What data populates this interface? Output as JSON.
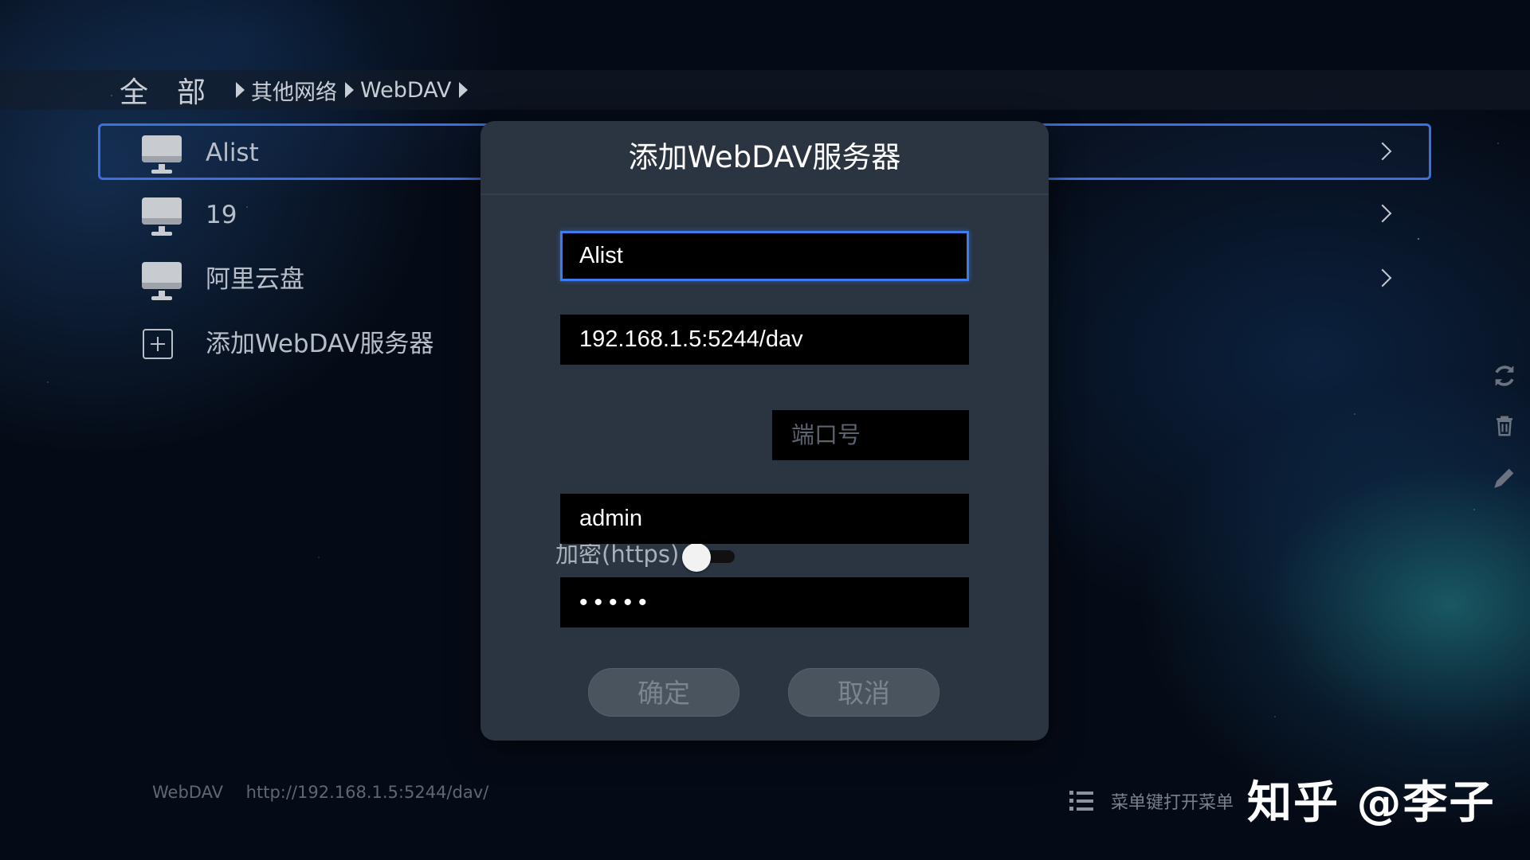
{
  "breadcrumb": {
    "root": "全部",
    "items": [
      "其他网络",
      "WebDAV"
    ]
  },
  "server_list": [
    {
      "label": "Alist",
      "icon": "monitor-icon",
      "selected": true
    },
    {
      "label": "19",
      "icon": "monitor-icon"
    },
    {
      "label": "阿里云盘",
      "icon": "monitor-icon"
    },
    {
      "label": "添加WebDAV服务器",
      "icon": "add-box-icon"
    }
  ],
  "dialog": {
    "title": "添加WebDAV服务器",
    "name_value": "Alist",
    "address_value": "192.168.1.5:5244/dav",
    "https_label": "加密(https)",
    "https_enabled": false,
    "port_placeholder": "端口号",
    "username_value": "admin",
    "password_value": "•••••",
    "confirm_label": "确定",
    "cancel_label": "取消"
  },
  "footer": {
    "type": "WebDAV",
    "url": "http://192.168.1.5:5244/dav/",
    "menu_hint": "菜单键打开菜单",
    "watermark": "知乎 @李子"
  },
  "side_icons": [
    "refresh-icon",
    "trash-icon",
    "edit-icon"
  ],
  "colors": {
    "accent": "#3d7cf0",
    "dialog_bg": "#2a3541",
    "field_bg": "#000000"
  }
}
